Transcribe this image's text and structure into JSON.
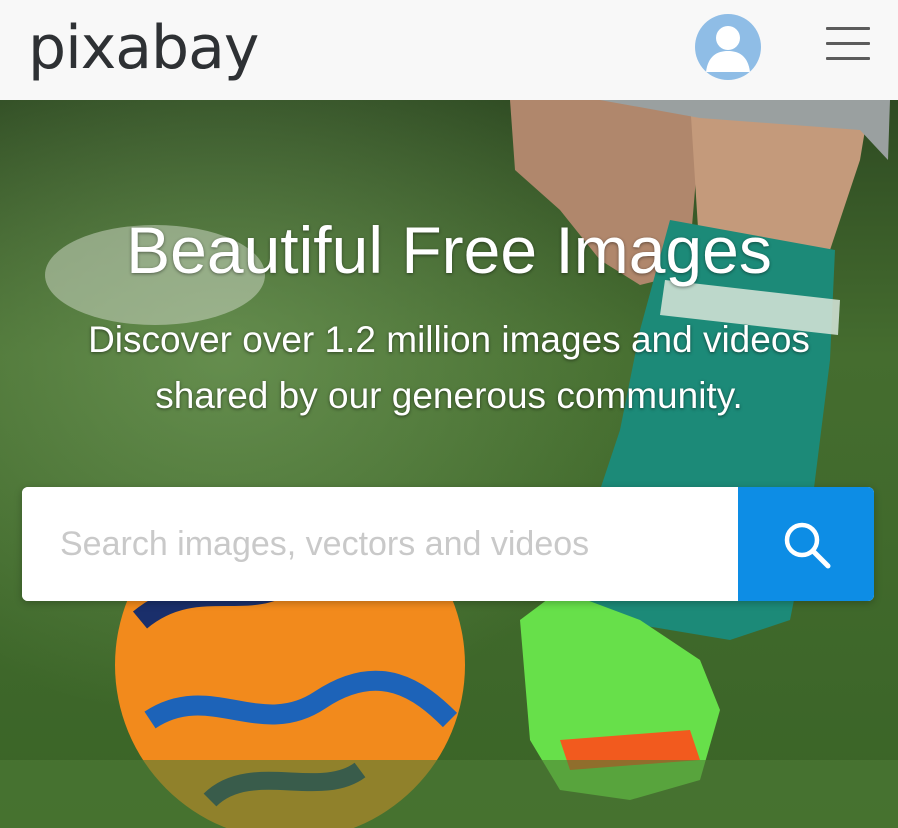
{
  "header": {
    "logo": "pixabay",
    "avatar_icon": "user-avatar-icon",
    "menu_icon": "hamburger-menu-icon"
  },
  "hero": {
    "title": "Beautiful Free Images",
    "subtitle": "Discover over 1.2 million images and videos shared by our generous community.",
    "background_image": "soccer-player-kicking-ball-on-grass"
  },
  "search": {
    "placeholder": "Search images, vectors and videos",
    "value": "",
    "button_icon": "search-icon"
  },
  "colors": {
    "header_bg": "#f8f8f8",
    "logo": "#2e3134",
    "avatar": "#8fbde6",
    "search_button": "#0d8de5",
    "text_on_hero": "#ffffff"
  }
}
